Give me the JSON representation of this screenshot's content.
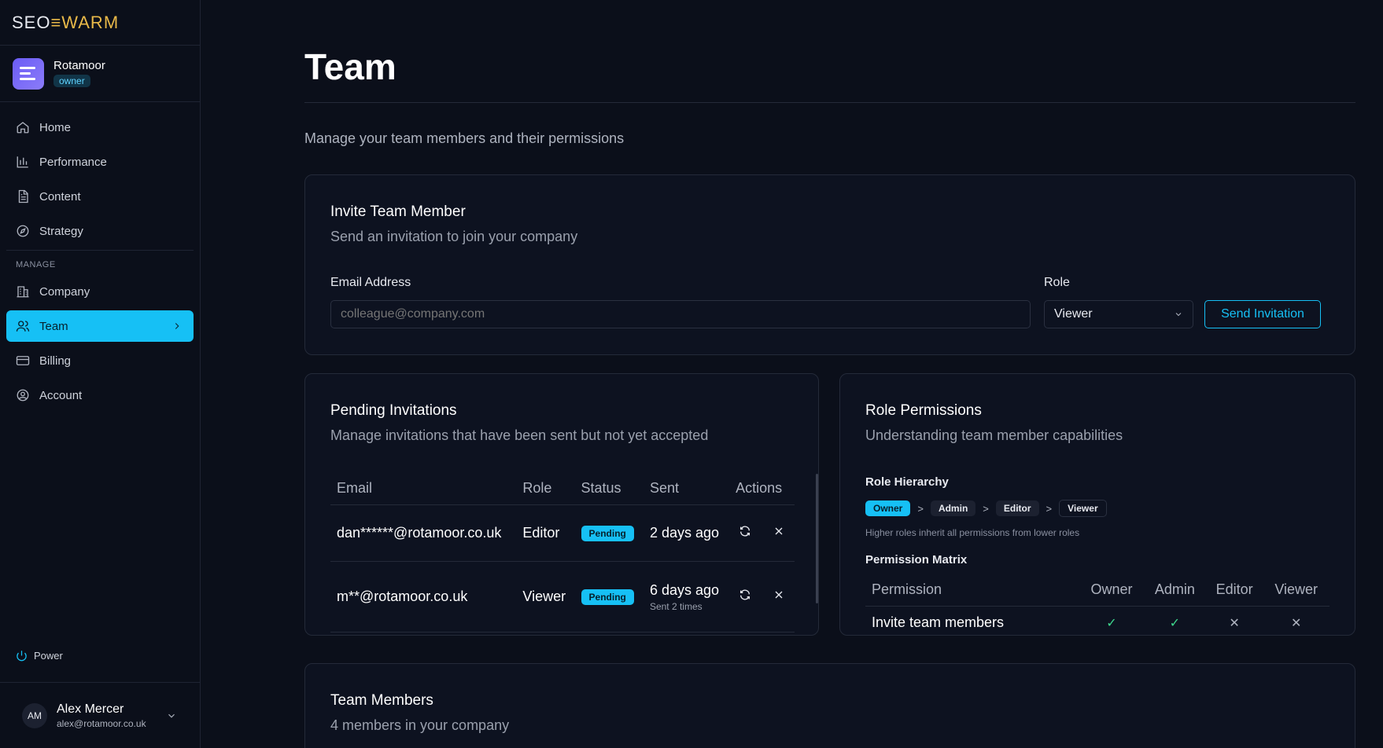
{
  "brand": {
    "part1": "SEO",
    "part2": "≡WARM"
  },
  "company": {
    "name": "Rotamoor",
    "role_badge": "owner"
  },
  "nav": {
    "items": [
      {
        "label": "Home",
        "icon": "home-icon"
      },
      {
        "label": "Performance",
        "icon": "bar-chart-icon"
      },
      {
        "label": "Content",
        "icon": "document-icon"
      },
      {
        "label": "Strategy",
        "icon": "compass-icon"
      }
    ],
    "section_label": "MANAGE",
    "manage_items": [
      {
        "label": "Company",
        "icon": "building-icon"
      },
      {
        "label": "Team",
        "icon": "users-icon",
        "active": true
      },
      {
        "label": "Billing",
        "icon": "credit-card-icon"
      },
      {
        "label": "Account",
        "icon": "user-circle-icon"
      }
    ],
    "power_label": "Power"
  },
  "user": {
    "initials": "AM",
    "name": "Alex Mercer",
    "email": "alex@rotamoor.co.uk"
  },
  "page": {
    "title": "Team",
    "subtitle": "Manage your team members and their permissions"
  },
  "invite": {
    "title": "Invite Team Member",
    "description": "Send an invitation to join your company",
    "email_label": "Email Address",
    "email_placeholder": "colleague@company.com",
    "role_label": "Role",
    "role_value": "Viewer",
    "send_label": "Send Invitation"
  },
  "pending": {
    "title": "Pending Invitations",
    "description": "Manage invitations that have been sent but not yet accepted",
    "columns": [
      "Email",
      "Role",
      "Status",
      "Sent",
      "Actions"
    ],
    "rows": [
      {
        "email": "dan******@rotamoor.co.uk",
        "role": "Editor",
        "status": "Pending",
        "sent": "2 days ago",
        "sent_note": ""
      },
      {
        "email": "m**@rotamoor.co.uk",
        "role": "Viewer",
        "status": "Pending",
        "sent": "6 days ago",
        "sent_note": "Sent 2 times"
      }
    ]
  },
  "permissions": {
    "title": "Role Permissions",
    "description": "Understanding team member capabilities",
    "hierarchy_label": "Role Hierarchy",
    "hierarchy": [
      "Owner",
      "Admin",
      "Editor",
      "Viewer"
    ],
    "separator": ">",
    "hierarchy_note": "Higher roles inherit all permissions from lower roles",
    "matrix_label": "Permission Matrix",
    "matrix_columns": [
      "Permission",
      "Owner",
      "Admin",
      "Editor",
      "Viewer"
    ],
    "matrix_rows": [
      {
        "permission": "Invite team members",
        "owner": "✓",
        "admin": "✓",
        "editor": "✕",
        "viewer": "✕"
      }
    ]
  },
  "members": {
    "title": "Team Members",
    "description": "4 members in your company"
  },
  "colors": {
    "accent": "#16c0f5",
    "background": "#0b0f1a",
    "brand_gold": "#e9b949",
    "check_green": "#3dd68c"
  }
}
